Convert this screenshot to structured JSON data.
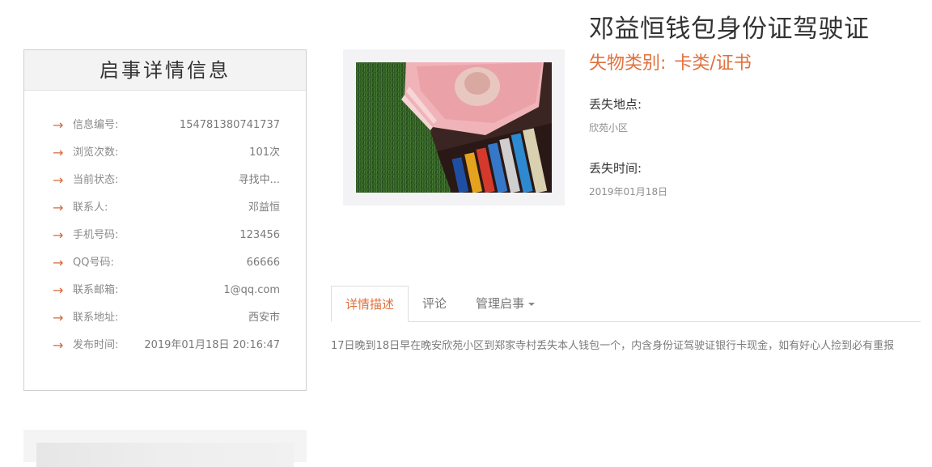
{
  "info_panel": {
    "title": "启事详情信息",
    "rows": [
      {
        "label": "信息编号:",
        "value": "154781380741737"
      },
      {
        "label": "浏览次数:",
        "value": "101次"
      },
      {
        "label": "当前状态:",
        "value": "寻找中..."
      },
      {
        "label": "联系人:",
        "value": "邓益恒"
      },
      {
        "label": "手机号码:",
        "value": "123456"
      },
      {
        "label": "QQ号码:",
        "value": "66666"
      },
      {
        "label": "联系邮箱:",
        "value": "1@qq.com"
      },
      {
        "label": "联系地址:",
        "value": "西安市"
      },
      {
        "label": "发布时间:",
        "value": "2019年01月18日 20:16:47"
      }
    ],
    "arrow_icon": "right-arrow-icon",
    "accent_color": "#e0703d"
  },
  "item": {
    "title": "邓益恒钱包身份证驾驶证",
    "category_label": "失物类别:",
    "category_value": "卡类/证书",
    "lost_place_label": "丢失地点:",
    "lost_place_value": "欣苑小区",
    "lost_time_label": "丢失时间:",
    "lost_time_value": "2019年01月18日"
  },
  "tabs": {
    "items": [
      {
        "label": "详情描述",
        "active": true
      },
      {
        "label": "评论",
        "active": false
      },
      {
        "label": "管理启事",
        "active": false,
        "dropdown": true
      }
    ]
  },
  "description": "17日晚到18日早在晚安欣苑小区到郑家寺村丢失本人钱包一个，内含身份证驾驶证银行卡现金，如有好心人捡到必有重报"
}
